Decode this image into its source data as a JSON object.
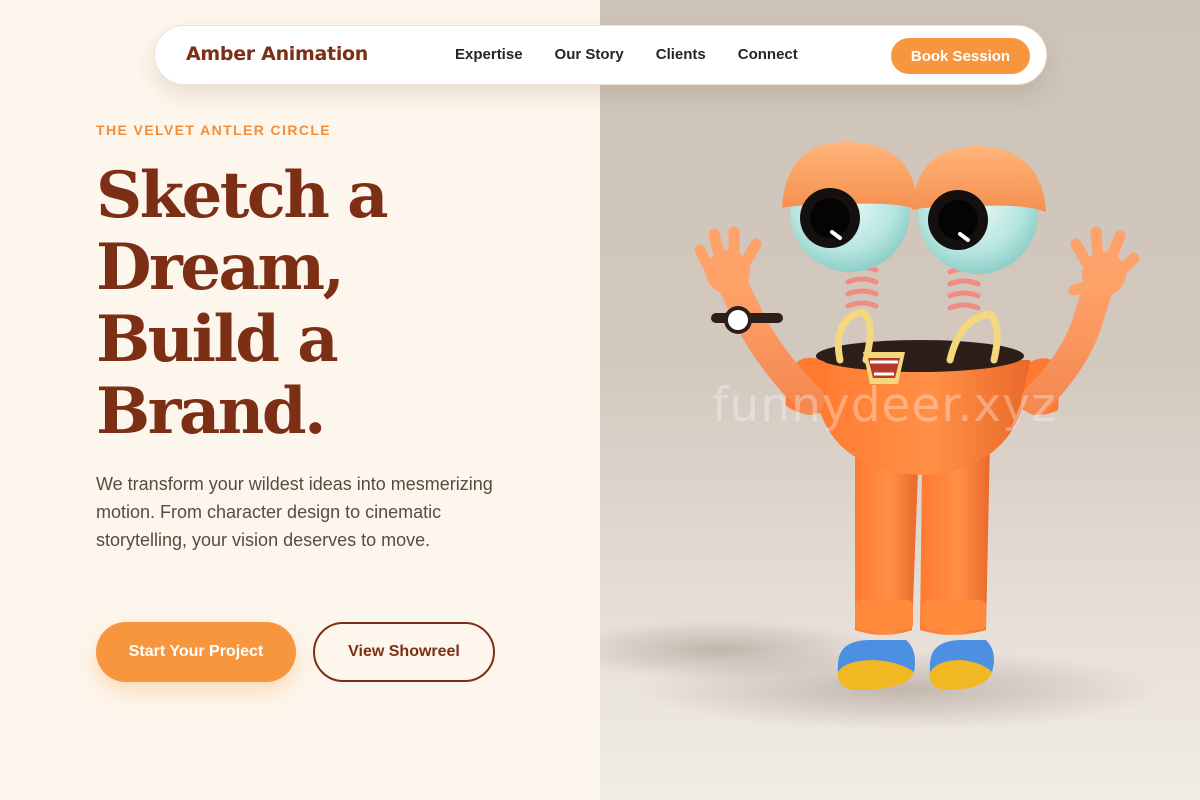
{
  "nav": {
    "brand": "Amber Animation",
    "links": [
      "Expertise",
      "Our Story",
      "Clients",
      "Connect"
    ],
    "cta": "Book Session"
  },
  "hero": {
    "eyebrow": "THE VELVET ANTLER CIRCLE",
    "headline_lines": [
      "Sketch a",
      "Dream,",
      "Build a",
      "Brand."
    ],
    "description": "We transform your wildest ideas into mesmerizing motion. From character design to cinematic storytelling, your vision deserves to move.",
    "primary_cta": "Start Your Project",
    "secondary_cta": "View Showreel"
  },
  "hero_image": {
    "subject": "3D orange cartoon character with two eyeballs on springs, wearing overalls and sneakers, waving both hands",
    "watermark": "funnydeer.xyz"
  },
  "colors": {
    "background": "#fdf6ec",
    "brand_brown": "#7c2f14",
    "accent_orange": "#f7963e",
    "body_text": "#5a4a42",
    "nav_text": "#2b2420"
  }
}
